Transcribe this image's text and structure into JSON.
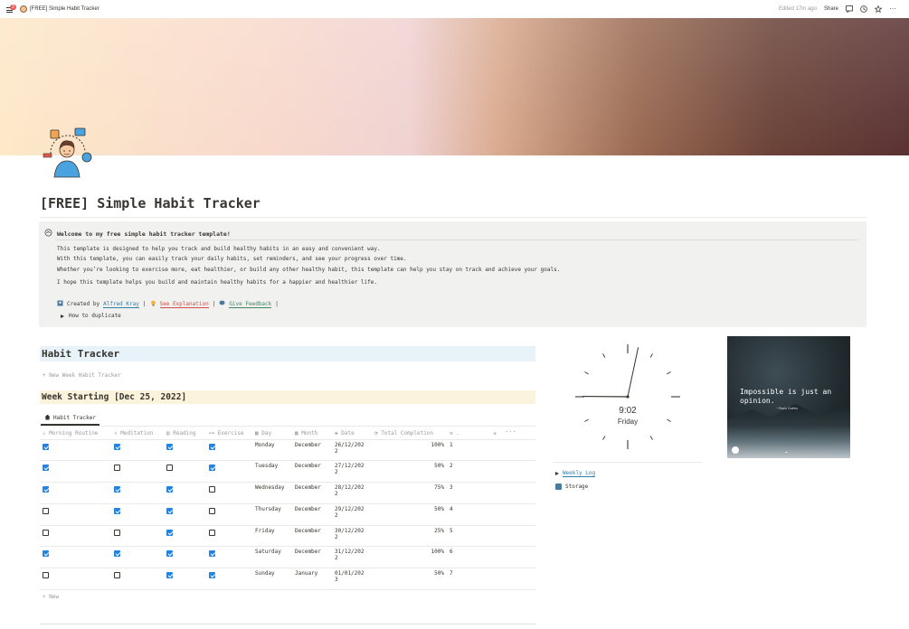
{
  "topbar": {
    "badge": "3",
    "page_title": "[FREE] Simple Habit Tracker",
    "edited": "Edited 17m ago",
    "share": "Share"
  },
  "page": {
    "title": "[FREE] Simple Habit Tracker"
  },
  "callout": {
    "heading": "Welcome to my free simple habit tracker template!",
    "line1": "This template is designed to help you track and build healthy habits in an easy and convenient way.",
    "line2": "With this template, you can easily track your daily habits, set reminders, and see your progress over time.",
    "line3": "Whether you’re looking to exercise more, eat healthier, or build any other healthy habit, this template can help you stay on track and achieve your goals.",
    "line4": "I hope this template helps you build and maintain healthy habits for a happier and healthier life.",
    "created_by": "Created by",
    "author": "Alfred Kray",
    "sep": "|",
    "see_explanation": "See Explanation",
    "give_feedback": "Give Feedback",
    "how_to_duplicate": "How to duplicate"
  },
  "habit_tracker": {
    "heading": "Habit Tracker",
    "new_week": "+ New Week Habit Tracker",
    "week_heading": "Week Starting [Dec 25, 2022]",
    "view_tab": "Habit Tracker",
    "columns": [
      "Morning Routine",
      "Meditation",
      "Reading",
      "Exercise",
      "Day",
      "Month",
      "Date",
      "Total Completion",
      "."
    ],
    "rows": [
      {
        "morning": true,
        "meditation": true,
        "reading": true,
        "exercise": true,
        "day": "Monday",
        "month": "December",
        "date1": "26/12/202",
        "date2": "2",
        "pct": "100%",
        "num": "1"
      },
      {
        "morning": true,
        "meditation": false,
        "reading": false,
        "exercise": true,
        "day": "Tuesday",
        "month": "December",
        "date1": "27/12/202",
        "date2": "2",
        "pct": "50%",
        "num": "2"
      },
      {
        "morning": true,
        "meditation": true,
        "reading": true,
        "exercise": false,
        "day": "Wednesday",
        "month": "December",
        "date1": "28/12/202",
        "date2": "2",
        "pct": "75%",
        "num": "3"
      },
      {
        "morning": false,
        "meditation": true,
        "reading": true,
        "exercise": false,
        "day": "Thursday",
        "month": "December",
        "date1": "29/12/202",
        "date2": "2",
        "pct": "50%",
        "num": "4"
      },
      {
        "morning": false,
        "meditation": false,
        "reading": true,
        "exercise": false,
        "day": "Friday",
        "month": "December",
        "date1": "30/12/202",
        "date2": "2",
        "pct": "25%",
        "num": "5"
      },
      {
        "morning": true,
        "meditation": true,
        "reading": true,
        "exercise": true,
        "day": "Saturday",
        "month": "December",
        "date1": "31/12/202",
        "date2": "2",
        "pct": "100%",
        "num": "6"
      },
      {
        "morning": false,
        "meditation": false,
        "reading": true,
        "exercise": true,
        "day": "Sunday",
        "month": "January",
        "date1": "01/01/202",
        "date2": "3",
        "pct": "50%",
        "num": "7"
      }
    ],
    "add_column": "+",
    "more": "···",
    "new_row": "+ New"
  },
  "clock": {
    "time": "9:02",
    "day": "Friday",
    "hour_value": 9.03,
    "minute_value": 2
  },
  "side_links": {
    "weekly_log": "Weekly Log",
    "storage": "Storage"
  },
  "quote": {
    "text": "Impossible is just an opinion.",
    "author": "~ Paulo Coelho"
  },
  "colors": {
    "checkbox_on": "#2383e2",
    "heading_blue_bg": "#e7f3f8",
    "heading_yellow_bg": "#fbf3db",
    "callout_bg": "#f1f1ef"
  }
}
